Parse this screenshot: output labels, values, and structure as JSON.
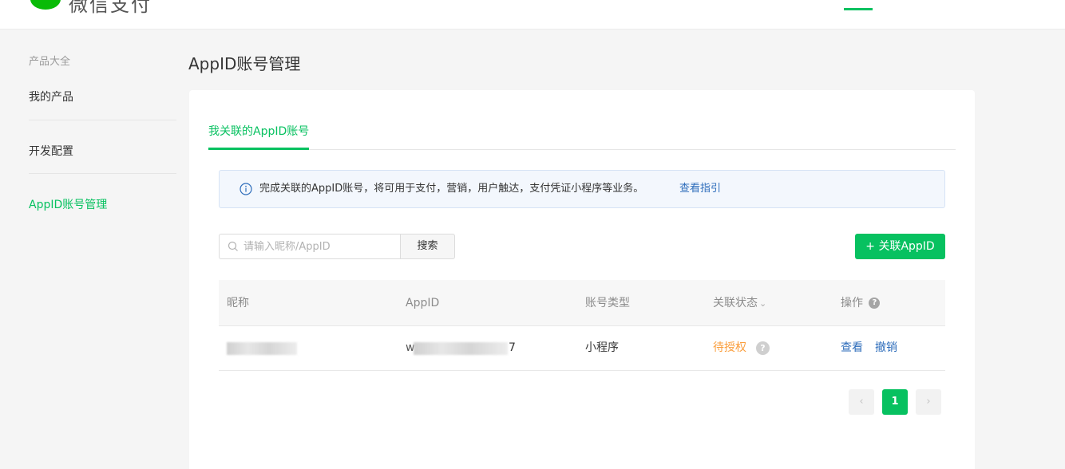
{
  "header": {
    "brand_text": "微信支付"
  },
  "sidebar": {
    "group_title": "产品大全",
    "items": [
      {
        "label": "我的产品"
      },
      {
        "label": "开发配置"
      },
      {
        "label": "AppID账号管理"
      }
    ]
  },
  "page": {
    "title": "AppID账号管理"
  },
  "tabs": [
    {
      "label": "我关联的AppID账号",
      "active": true
    }
  ],
  "notice": {
    "message": "完成关联的AppID账号，将可用于支付，营销，用户触达，支付凭证小程序等业务。",
    "guide_link": "查看指引",
    "icon": "info-icon"
  },
  "search": {
    "placeholder": "请输入昵称/AppID",
    "button_label": "搜索",
    "icon": "search-icon"
  },
  "add_button": {
    "label": "+ 关联AppID"
  },
  "table": {
    "columns": [
      "昵称",
      "AppID",
      "账号类型",
      "关联状态",
      "操作"
    ],
    "status_sort_glyph": "⌄",
    "help_glyph": "?",
    "rows": [
      {
        "nickname": "",
        "appid_prefix": "w",
        "appid_suffix": "7",
        "type": "小程序",
        "status": "待授权",
        "actions": [
          "查看",
          "撤销"
        ]
      }
    ]
  },
  "pagination": {
    "prev": "‹",
    "current": "1",
    "next": "›"
  },
  "colors": {
    "brand_green": "#07c160",
    "link_blue": "#2e6dbb",
    "pending_orange": "#fa9d3b"
  }
}
